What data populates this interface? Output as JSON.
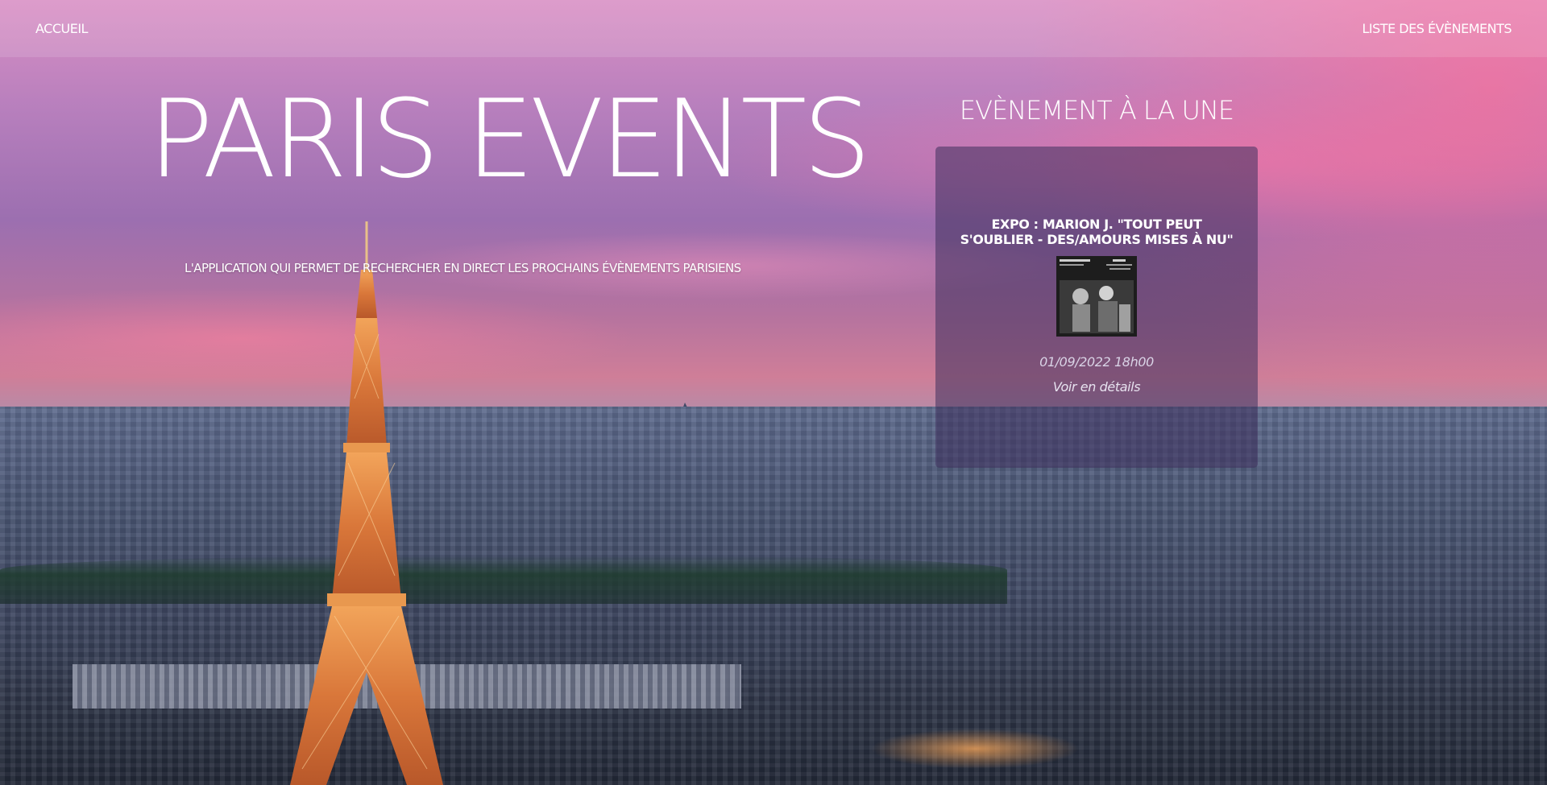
{
  "nav": {
    "home_label": "ACCUEIL",
    "events_label": "LISTE DES ÉVÈNEMENTS"
  },
  "hero": {
    "title": "PARIS EVENTS",
    "subtitle": "L'APPLICATION QUI PERMET DE RECHERCHER EN DIRECT LES PROCHAINS ÉVÈNEMENTS PARISIENS"
  },
  "featured": {
    "heading": "EVÈNEMENT À LA UNE",
    "event": {
      "title": "EXPO : MARION J. \"TOUT PEUT S'OUBLIER - DES/AMOURS MISES À NU\"",
      "date": "01/09/2022 18h00",
      "details_link": "Voir en détails"
    }
  }
}
